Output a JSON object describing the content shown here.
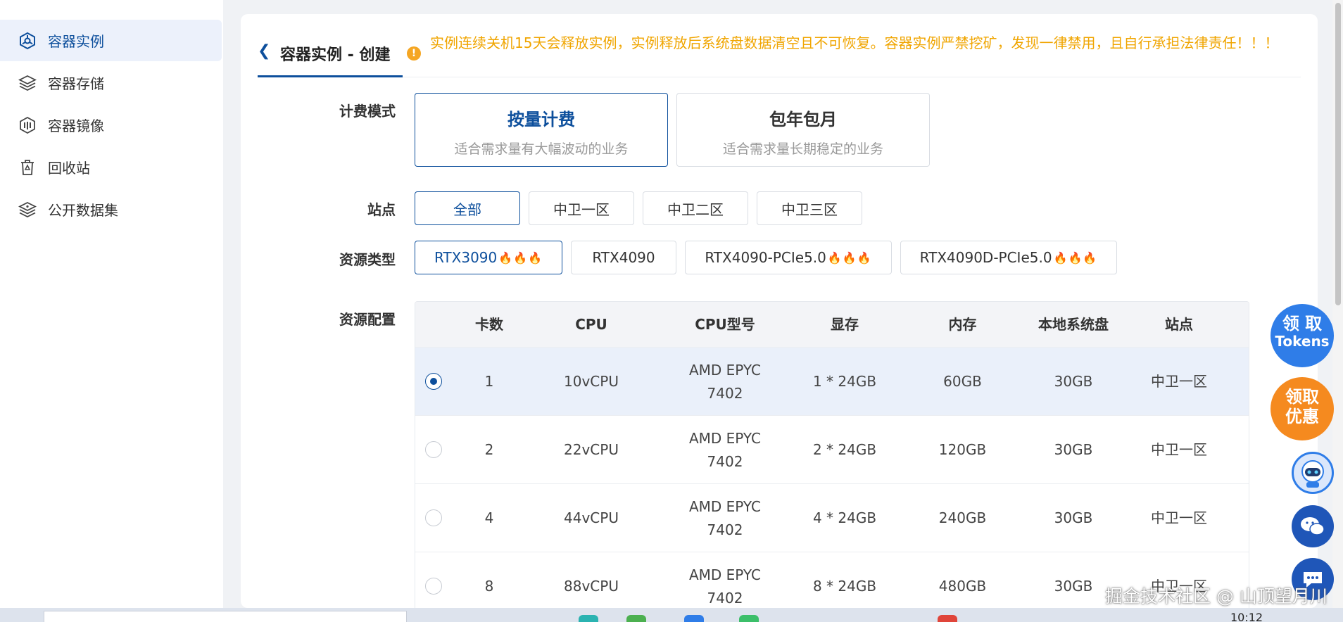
{
  "sidebar": {
    "items": [
      {
        "label": "容器实例",
        "icon": "container-instance-icon",
        "active": true
      },
      {
        "label": "容器存储",
        "icon": "layers-icon",
        "active": false
      },
      {
        "label": "容器镜像",
        "icon": "image-cube-icon",
        "active": false
      },
      {
        "label": "回收站",
        "icon": "trash-icon",
        "active": false
      },
      {
        "label": "公开数据集",
        "icon": "dataset-icon",
        "active": false
      }
    ]
  },
  "header": {
    "back_icon": "chevron-left-icon",
    "title": "容器实例 - 创建",
    "notice_icon": "warning-icon",
    "notice": "实例连续关机15天会释放实例，实例释放后系统盘数据清空且不可恢复。容器实例严禁挖矿，发现一律禁用，且自行承担法律责任！！！"
  },
  "billing": {
    "label": "计费模式",
    "options": [
      {
        "title": "按量计费",
        "desc": "适合需求量有大幅波动的业务",
        "selected": true
      },
      {
        "title": "包年包月",
        "desc": "适合需求量长期稳定的业务",
        "selected": false
      }
    ]
  },
  "site": {
    "label": "站点",
    "options": [
      "全部",
      "中卫一区",
      "中卫二区",
      "中卫三区"
    ],
    "selected": "全部"
  },
  "resource_type": {
    "label": "资源类型",
    "options": [
      {
        "label": "RTX3090",
        "hot": true,
        "selected": true
      },
      {
        "label": "RTX4090",
        "hot": false,
        "selected": false
      },
      {
        "label": "RTX4090-PCIe5.0",
        "hot": true,
        "selected": false
      },
      {
        "label": "RTX4090D-PCIe5.0",
        "hot": true,
        "selected": false
      }
    ],
    "hot_icon": "fire-icon"
  },
  "resource_config": {
    "label": "资源配置",
    "columns": [
      "卡数",
      "CPU",
      "CPU型号",
      "显存",
      "内存",
      "本地系统盘",
      "站点"
    ],
    "rows": [
      {
        "cards": "1",
        "cpu": "10vCPU",
        "cpu_model": "AMD EPYC 7402",
        "vram": "1 * 24GB",
        "memory": "60GB",
        "disk": "30GB",
        "site": "中卫一区",
        "selected": true
      },
      {
        "cards": "2",
        "cpu": "22vCPU",
        "cpu_model": "AMD EPYC 7402",
        "vram": "2 * 24GB",
        "memory": "120GB",
        "disk": "30GB",
        "site": "中卫一区",
        "selected": false
      },
      {
        "cards": "4",
        "cpu": "44vCPU",
        "cpu_model": "AMD EPYC 7402",
        "vram": "4 * 24GB",
        "memory": "240GB",
        "disk": "30GB",
        "site": "中卫一区",
        "selected": false
      },
      {
        "cards": "8",
        "cpu": "88vCPU",
        "cpu_model": "AMD EPYC 7402",
        "vram": "8 * 24GB",
        "memory": "480GB",
        "disk": "30GB",
        "site": "中卫一区",
        "selected": false
      }
    ]
  },
  "floating": {
    "tokens_line1": "领 取",
    "tokens_line2": "Tokens",
    "discount_line1": "领取",
    "discount_line2": "优惠",
    "robot_icon": "robot-assistant-icon",
    "wechat_icon": "wechat-icon",
    "chat_icon": "chat-icon"
  },
  "watermark": "掘金技术社区 @ 山顶望月川",
  "taskbar": {
    "time": "10:12"
  },
  "colors": {
    "accent": "#0d4f9c",
    "warning": "#f0a500",
    "fire": "#f08a24",
    "selected_row": "#eaf0fa"
  }
}
